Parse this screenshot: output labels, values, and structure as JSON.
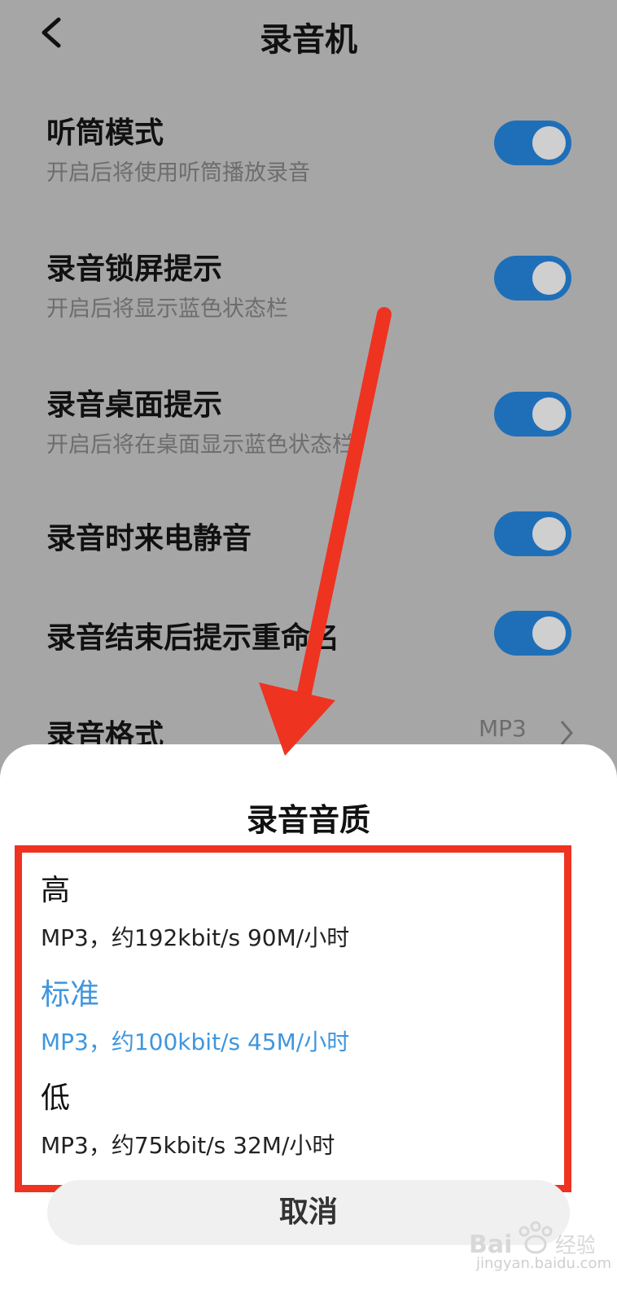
{
  "header": {
    "title": "录音机",
    "back_icon": "chevron-left-icon"
  },
  "settings": [
    {
      "title": "听筒模式",
      "subtitle": "开启后将使用听筒播放录音",
      "enabled": true
    },
    {
      "title": "录音锁屏提示",
      "subtitle": "开启后将显示蓝色状态栏",
      "enabled": true
    },
    {
      "title": "录音桌面提示",
      "subtitle": "开启后将在桌面显示蓝色状态栏",
      "enabled": true
    },
    {
      "title": "录音时来电静音",
      "enabled": true
    },
    {
      "title": "录音结束后提示重命名",
      "enabled": true
    }
  ],
  "format_row": {
    "title": "录音格式",
    "value": "MP3",
    "icon": "chevron-right-icon"
  },
  "sheet": {
    "title": "录音音质",
    "options": [
      {
        "label": "高",
        "desc": "MP3，约192kbit/s 90M/小时",
        "selected": false
      },
      {
        "label": "标准",
        "desc": "MP3，约100kbit/s 45M/小时",
        "selected": true
      },
      {
        "label": "低",
        "desc": "MP3，约75kbit/s 32M/小时",
        "selected": false
      }
    ],
    "cancel_label": "取消"
  },
  "annotation": {
    "arrow_color": "#ee3321",
    "highlight_color": "#ee3321"
  },
  "colors": {
    "toggle_on": "#1f6fb8",
    "selected_text": "#3f96de"
  },
  "watermark": {
    "logo": "baidu-jingyan-logo",
    "text": "jingyan.baidu.com"
  }
}
